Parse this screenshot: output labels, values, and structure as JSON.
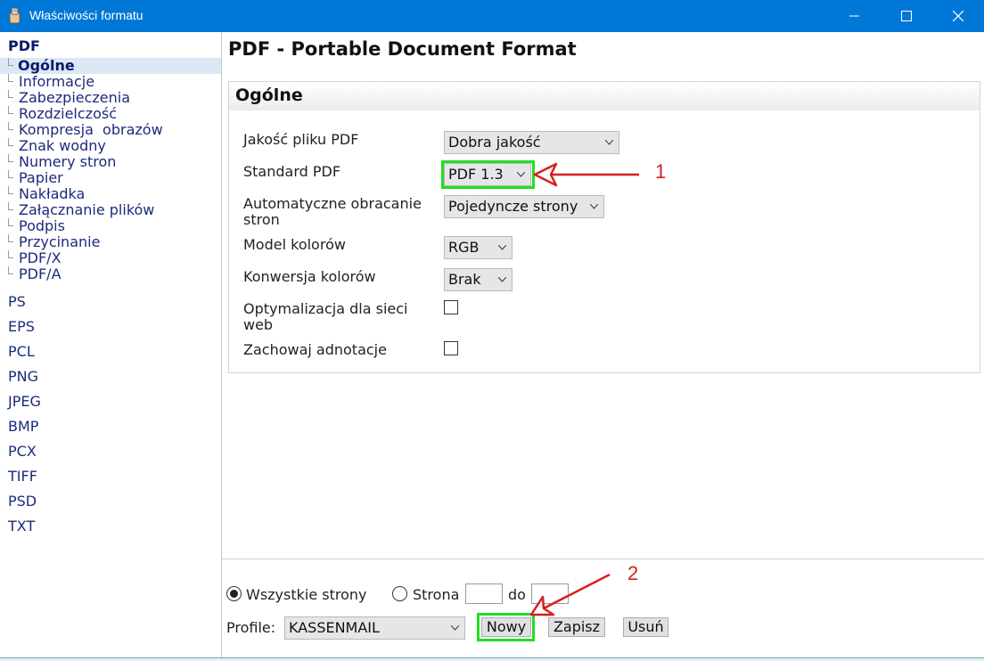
{
  "window": {
    "title": "Właściwości formatu"
  },
  "sidebar": {
    "active_group": "PDF",
    "sub_items": [
      {
        "label": "Ogólne",
        "selected": true
      },
      {
        "label": "Informacje"
      },
      {
        "label": "Zabezpieczenia"
      },
      {
        "label": "Rozdzielczość"
      },
      {
        "label": "Kompresja  obrazów"
      },
      {
        "label": "Znak wodny"
      },
      {
        "label": "Numery stron"
      },
      {
        "label": "Papier"
      },
      {
        "label": "Nakładka"
      },
      {
        "label": "Załącznanie plików"
      },
      {
        "label": "Podpis"
      },
      {
        "label": "Przycinanie"
      },
      {
        "label": "PDF/X"
      },
      {
        "label": "PDF/A"
      }
    ],
    "formats": [
      "PS",
      "EPS",
      "PCL",
      "PNG",
      "JPEG",
      "BMP",
      "PCX",
      "TIFF",
      "PSD",
      "TXT"
    ]
  },
  "main": {
    "title": "PDF - Portable Document Format",
    "section_title": "Ogólne",
    "fields": {
      "quality": {
        "label": "Jakość pliku PDF",
        "value": "Dobra jakość"
      },
      "standard": {
        "label": "Standard PDF",
        "value": "PDF 1.3"
      },
      "rotation": {
        "label_line1": "Automatyczne obracanie",
        "label_line2": "stron",
        "value": "Pojedyncze strony"
      },
      "color_model": {
        "label": "Model kolorów",
        "value": "RGB"
      },
      "color_conversion": {
        "label": "Konwersja kolorów",
        "value": "Brak"
      },
      "web_optimize": {
        "label_line1": "Optymalizacja dla sieci",
        "label_line2": "web",
        "checked": false
      },
      "keep_annotations": {
        "label": "Zachowaj adnotacje",
        "checked": false
      }
    }
  },
  "bottom": {
    "all_pages_label": "Wszystkie strony",
    "all_pages_selected": true,
    "page_label": "Strona",
    "page_from": "",
    "to_label": "do",
    "page_to": "",
    "profile_label": "Profile:",
    "profile_value": "KASSENMAIL",
    "new_button": "Nowy",
    "save_button": "Zapisz",
    "delete_button": "Usuń"
  },
  "annotations": {
    "marker_1": "1",
    "marker_2": "2",
    "highlight_color": "#22dd22",
    "arrow_color": "#d81e1e"
  },
  "colors": {
    "titlebar": "#0078d7",
    "nav_text": "#1b2b7b",
    "selected_bg": "#dbe8f6"
  }
}
